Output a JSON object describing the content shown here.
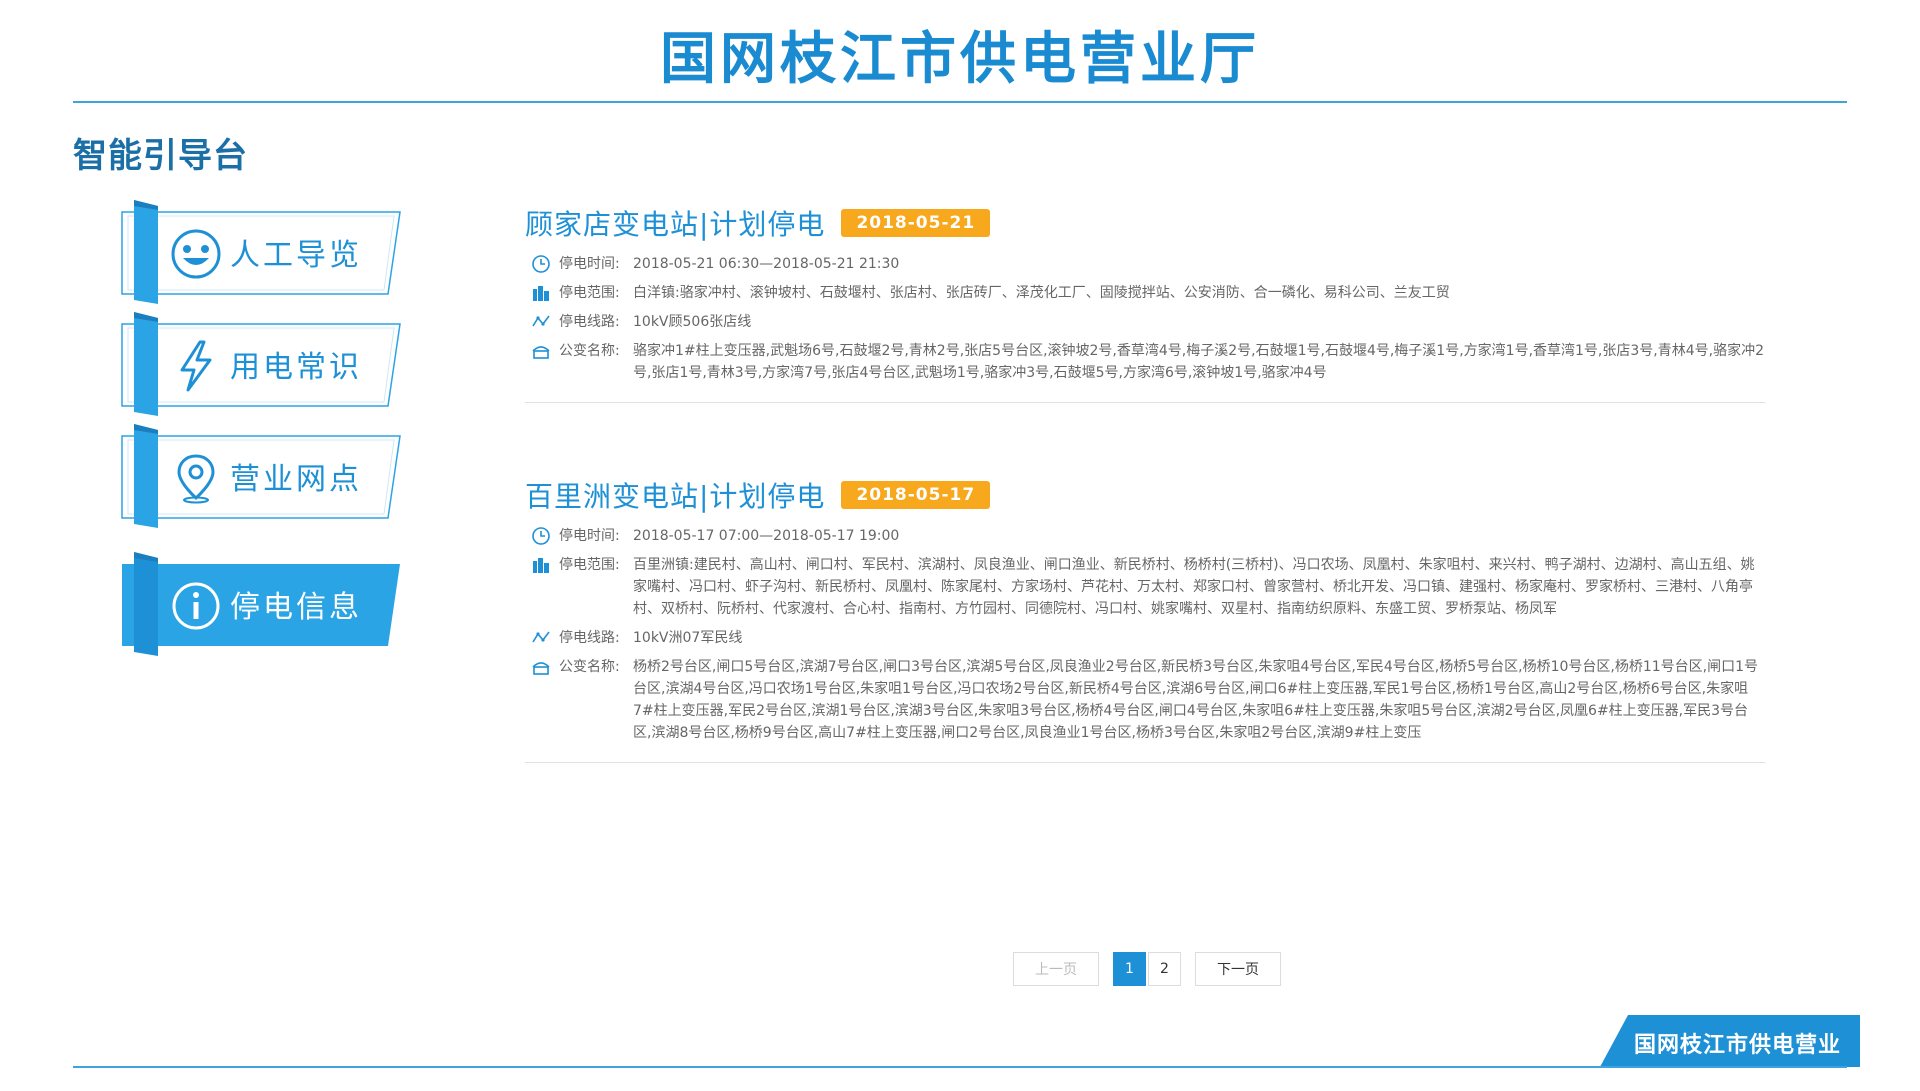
{
  "header": {
    "title": "国网枝江市供电营业厅"
  },
  "section": {
    "title": "智能引导台"
  },
  "menu": [
    {
      "label": "人工导览",
      "icon": "smiley-icon"
    },
    {
      "label": "用电常识",
      "icon": "lightning-icon"
    },
    {
      "label": "营业网点",
      "icon": "location-pin-icon"
    },
    {
      "label": "停电信息",
      "icon": "info-icon",
      "active": true
    }
  ],
  "notices": [
    {
      "title": "顾家店变电站|计划停电",
      "date": "2018-05-21",
      "time_label": "停电时间:",
      "time": "2018-05-21 06:30—2018-05-21 21:30",
      "range_label": "停电范围:",
      "range": "白洋镇:骆家冲村、滚钟坡村、石鼓堰村、张店村、张店砖厂、泽茂化工厂、固陵搅拌站、公安消防、合一磷化、易科公司、兰友工贸",
      "line_label": "停电线路:",
      "line": "10kV顾506张店线",
      "transformer_label": "公变名称:",
      "transformer": "骆家冲1#柱上变压器,武魁场6号,石鼓堰2号,青林2号,张店5号台区,滚钟坡2号,香草湾4号,梅子溪2号,石鼓堰1号,石鼓堰4号,梅子溪1号,方家湾1号,香草湾1号,张店3号,青林4号,骆家冲2号,张店1号,青林3号,方家湾7号,张店4号台区,武魁场1号,骆家冲3号,石鼓堰5号,方家湾6号,滚钟坡1号,骆家冲4号"
    },
    {
      "title": "百里洲变电站|计划停电",
      "date": "2018-05-17",
      "time_label": "停电时间:",
      "time": "2018-05-17 07:00—2018-05-17 19:00",
      "range_label": "停电范围:",
      "range": "百里洲镇:建民村、高山村、闸口村、军民村、滨湖村、凤良渔业、闸口渔业、新民桥村、杨桥村(三桥村)、冯口农场、凤凰村、朱家咀村、来兴村、鸭子湖村、边湖村、高山五组、姚家嘴村、冯口村、虾子沟村、新民桥村、凤凰村、陈家尾村、方家场村、芦花村、万太村、郑家口村、曾家营村、桥北开发、冯口镇、建强村、杨家庵村、罗家桥村、三港村、八角亭村、双桥村、阮桥村、代家渡村、合心村、指南村、方竹园村、同德院村、冯口村、姚家嘴村、双星村、指南纺织原料、东盛工贸、罗桥泵站、杨凤军",
      "line_label": "停电线路:",
      "line": "10kV洲07军民线",
      "transformer_label": "公变名称:",
      "transformer": "杨桥2号台区,闸口5号台区,滨湖7号台区,闸口3号台区,滨湖5号台区,凤良渔业2号台区,新民桥3号台区,朱家咀4号台区,军民4号台区,杨桥5号台区,杨桥10号台区,杨桥11号台区,闸口1号台区,滨湖4号台区,冯口农场1号台区,朱家咀1号台区,冯口农场2号台区,新民桥4号台区,滨湖6号台区,闸口6#柱上变压器,军民1号台区,杨桥1号台区,高山2号台区,杨桥6号台区,朱家咀7#柱上变压器,军民2号台区,滨湖1号台区,滨湖3号台区,朱家咀3号台区,杨桥4号台区,闸口4号台区,朱家咀6#柱上变压器,朱家咀5号台区,滨湖2号台区,凤凰6#柱上变压器,军民3号台区,滨湖8号台区,杨桥9号台区,高山7#柱上变压器,闸口2号台区,凤良渔业1号台区,杨桥3号台区,朱家咀2号台区,滨湖9#柱上变压"
    }
  ],
  "pagination": {
    "prev": "上一页",
    "pages": [
      "1",
      "2"
    ],
    "current": "1",
    "next": "下一页"
  },
  "footer": {
    "badge": "国网枝江市供电营业厅"
  },
  "colors": {
    "primary": "#1e90d6",
    "accent": "#f7a81c",
    "active_menu": "#2ba4e6"
  }
}
